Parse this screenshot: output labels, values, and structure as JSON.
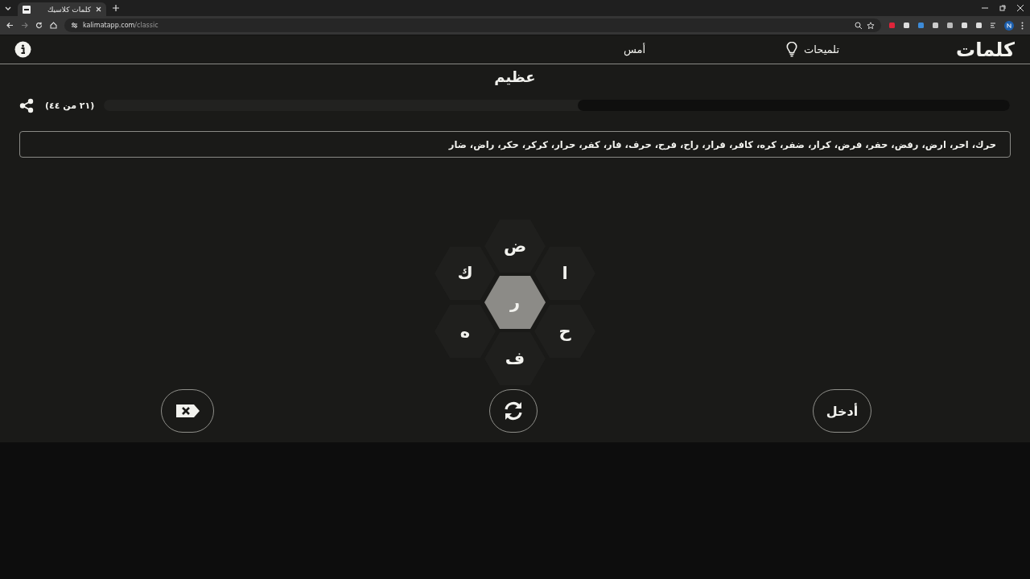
{
  "browser": {
    "tab_title": "كلمات كلاسيك",
    "url": "kalimatapp.com/classic"
  },
  "header": {
    "logo": "كلمات",
    "hints": "تلميحات",
    "yesterday": "أمس"
  },
  "rank": "عظيم",
  "progress": {
    "count": "(٢١ من ٤٤)",
    "level": 0.477
  },
  "found_words": "حرك، احر، ارض، رفض، حفر، فرض، كرار، ضفر، كره، كافر، فرار، راح، فرح، حرف، فار، كفر، حرار، كركر، حكر، راض، ضار",
  "board": {
    "center": "ر",
    "outer": [
      "ض",
      "ا",
      "ح",
      "ف",
      "ه",
      "ك"
    ]
  },
  "buttons": {
    "enter": "أدخل"
  }
}
